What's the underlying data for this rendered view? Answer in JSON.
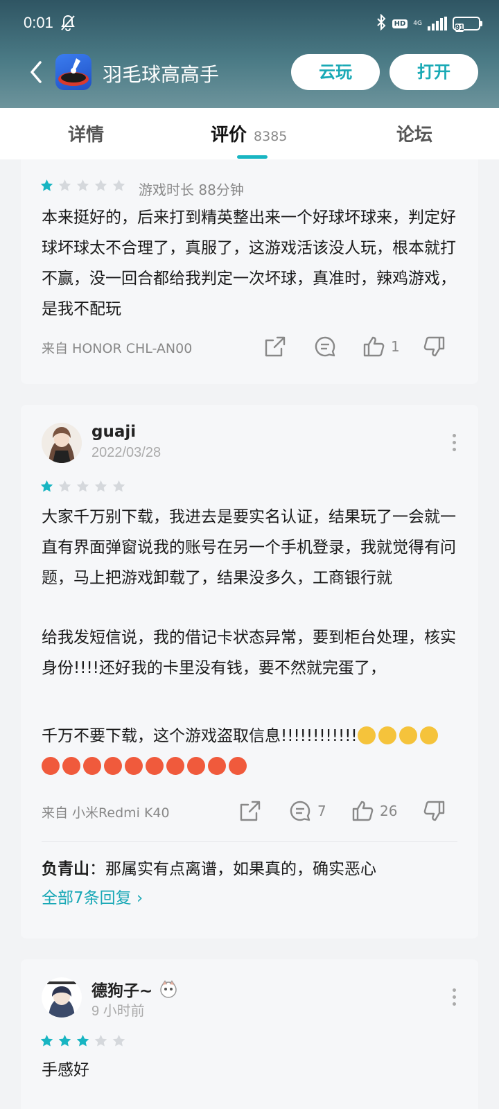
{
  "status_bar": {
    "time": "0:01",
    "hd": "HD",
    "network": "4G",
    "battery": "91"
  },
  "app_bar": {
    "title": "羽毛球高高手",
    "cloud_play_label": "云玩",
    "open_label": "打开"
  },
  "tabs": {
    "details": "详情",
    "reviews": "评价",
    "reviews_count": "8385",
    "forum": "论坛"
  },
  "reviews": [
    {
      "rating": 1,
      "playtime": "游戏时长 88分钟",
      "paragraphs": [
        "本来挺好的，后来打到精英整出来一个好球坏球来，判定好球坏球太不合理了，真服了，这游戏活该没人玩，根本就打不赢，没一回合都给我判定一次坏球，真准时，辣鸡游戏，是我不配玩"
      ],
      "device": "来自 HONOR CHL-AN00",
      "likes": "1"
    },
    {
      "username": "guaji",
      "date": "2022/03/28",
      "rating": 1,
      "paragraphs": [
        "大家千万别下载，我进去是要实名认证，结果玩了一会就一直有界面弹窗说我的账号在另一个手机登录，我就觉得有问题，马上把游戏卸载了，结果没多久，工商银行就",
        "给我发短信说，我的借记卡状态异常，要到柜台处理，核实身份!!!!还好我的卡里没有钱，要不然就完蛋了，",
        "千万不要下载，这个游戏盗取信息!!!!!!!!!!!!"
      ],
      "device": "来自 小米Redmi K40",
      "comments": "7",
      "likes": "26",
      "top_reply": {
        "author": "负青山",
        "text": "：那属实有点离谱，如果真的，确实恶心"
      },
      "all_replies": "全部7条回复 ›"
    },
    {
      "username": "德狗子~",
      "date": "9 小时前",
      "rating": 3,
      "paragraphs": [
        "手感好"
      ]
    }
  ],
  "colors": {
    "accent": "#18b5c2",
    "star_on": "#18b5c2",
    "star_off": "#d5d8dc"
  }
}
